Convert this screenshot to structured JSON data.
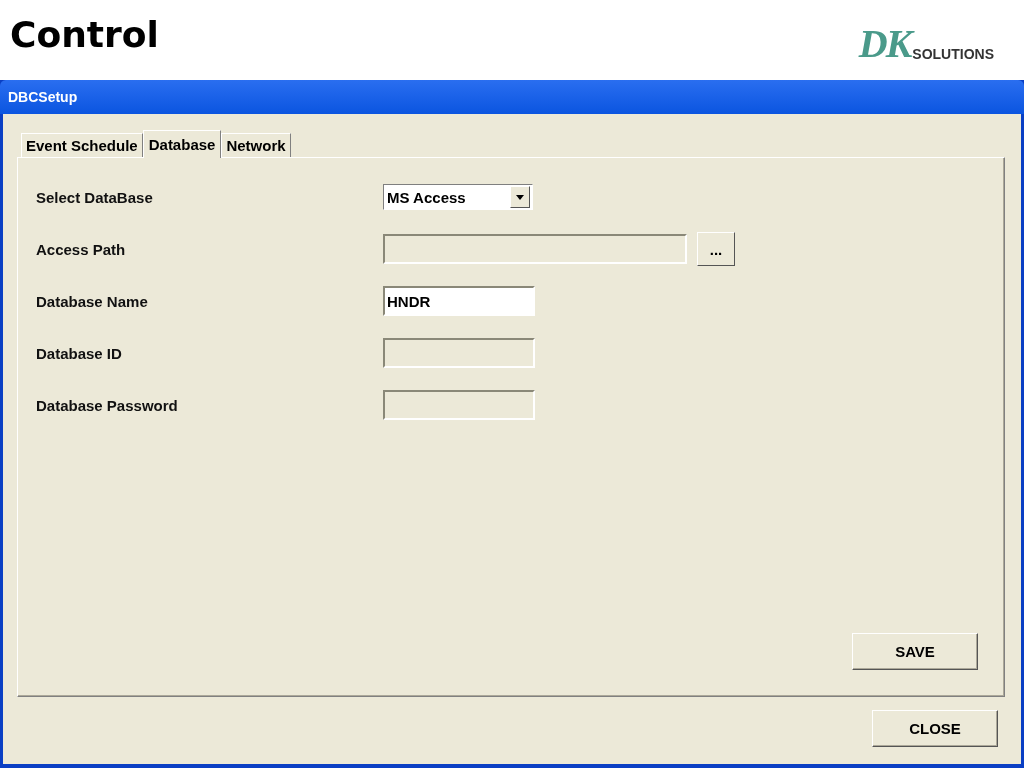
{
  "slide": {
    "title": "Control",
    "logo": {
      "mark": "DK",
      "text": "SOLUTIONS"
    }
  },
  "window": {
    "title": "DBCSetup"
  },
  "tabs": [
    {
      "label": "Event Schedule",
      "selected": false
    },
    {
      "label": "Database",
      "selected": true
    },
    {
      "label": "Network",
      "selected": false
    }
  ],
  "fields": [
    {
      "kind": "combo",
      "label": "Select DataBase",
      "value": "MS Access",
      "disabled": false
    },
    {
      "kind": "path",
      "label": "Access Path",
      "disabled": true,
      "browse": "..."
    },
    {
      "kind": "text",
      "label": "Database Name",
      "value": "HNDR",
      "disabled": false
    },
    {
      "kind": "text",
      "label": "Database ID",
      "disabled": true
    },
    {
      "kind": "text",
      "label": "Database Password",
      "disabled": true
    }
  ],
  "buttons": {
    "save": "SAVE",
    "close": "CLOSE"
  }
}
